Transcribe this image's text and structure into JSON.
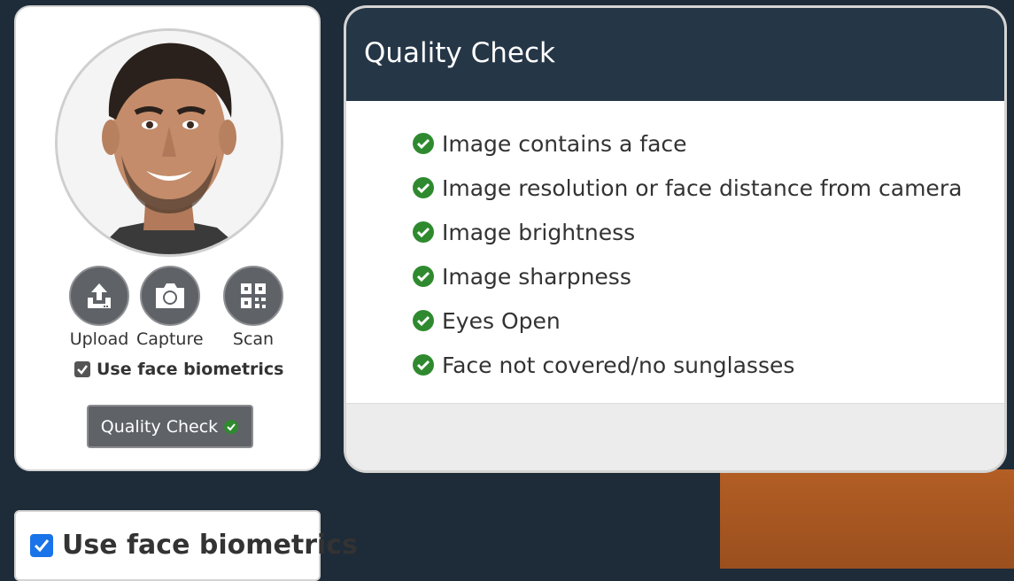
{
  "tools": [
    {
      "label": "Upload",
      "icon": "upload-icon"
    },
    {
      "label": "Capture",
      "icon": "camera-icon"
    },
    {
      "label": "Scan",
      "icon": "qr-code-icon"
    }
  ],
  "biometrics_label": "Use face biometrics",
  "biometrics_checked": true,
  "quality_button_label": "Quality Check",
  "quality_panel": {
    "title": "Quality Check",
    "items": [
      "Image contains a face",
      "Image resolution or face distance from camera",
      "Image brightness",
      "Image sharpness",
      "Eyes Open",
      "Face not covered/no sunglasses"
    ]
  },
  "bio_panel_label": "Use face biometrics",
  "colors": {
    "check_green": "#2f8a2f",
    "header_bg": "#253647",
    "checkbox_blue": "#1a73e8"
  }
}
